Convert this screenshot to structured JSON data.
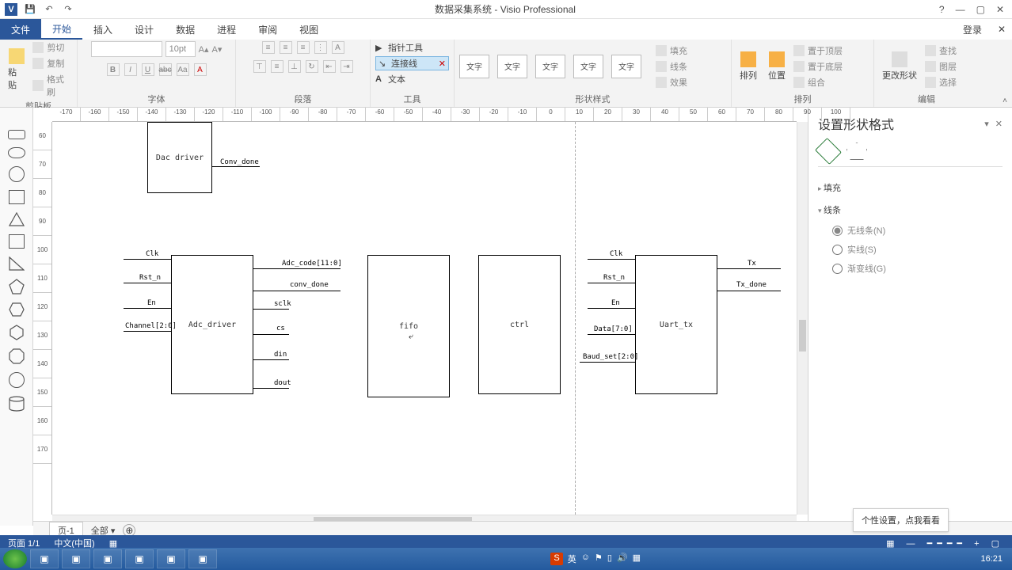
{
  "titlebar": {
    "title": "数据采集系统 - Visio Professional"
  },
  "qat": {
    "save": "💾",
    "undo": "↶",
    "redo": "↷"
  },
  "winbtns": {
    "help": "?",
    "min": "—",
    "max": "▢",
    "close": "✕"
  },
  "tabs": {
    "file": "文件",
    "home": "开始",
    "insert": "插入",
    "design": "设计",
    "data": "数据",
    "process": "进程",
    "review": "审阅",
    "view": "视图",
    "login": "登录",
    "closex": "✕"
  },
  "ribbon": {
    "clipboard": {
      "paste": "粘贴",
      "cut": "剪切",
      "copy": "复制",
      "format_painter": "格式刷",
      "label": "剪贴板"
    },
    "font": {
      "size": "10pt",
      "bold": "B",
      "italic": "I",
      "underline": "U",
      "strike": "abc",
      "case": "Aa",
      "color": "A",
      "grow": "A^",
      "shrink": "A˅",
      "label": "字体"
    },
    "paragraph": {
      "label": "段落"
    },
    "tools": {
      "pointer": "指针工具",
      "connector": "连接线",
      "text": "文本",
      "x": "✕",
      "label": "工具"
    },
    "styles": {
      "swatch": "文字",
      "label": "形状样式",
      "fill": "填充",
      "line": "线条",
      "effects": "效果"
    },
    "arrange": {
      "arrange": "排列",
      "position": "位置",
      "bring_front": "置于顶层",
      "send_back": "置于底层",
      "group": "组合",
      "label": "排列"
    },
    "edit": {
      "change_shape": "更改形状",
      "find": "查找",
      "layers": "图层",
      "select": "选择",
      "label": "编辑"
    }
  },
  "hruler": [
    "-170",
    "-160",
    "-150",
    "-140",
    "-130",
    "-120",
    "-110",
    "-100",
    "-90",
    "-80",
    "-70",
    "-60",
    "-50",
    "-40",
    "-30",
    "-20",
    "-10",
    "0",
    "10",
    "20",
    "30",
    "40",
    "50",
    "60",
    "70",
    "80",
    "90",
    "100"
  ],
  "vruler": [
    "60",
    "70",
    "80",
    "90",
    "100",
    "110",
    "120",
    "130",
    "140",
    "150",
    "160",
    "170"
  ],
  "diagram": {
    "blocks": {
      "dac": "Dac driver",
      "adc": "Adc_driver",
      "fifo": "fifo",
      "ctrl": "ctrl",
      "uart": "Uart_tx"
    },
    "labels": {
      "conv_done_top": "Conv_done",
      "clk1": "Clk",
      "rstn1": "Rst_n",
      "en1": "En",
      "channel": "Channel[2:0]",
      "adc_code": "Adc_code[11:0]",
      "conv_done": "conv_done",
      "sclk": "sclk",
      "cs": "cs",
      "din": "din",
      "dout": "dout",
      "clk2": "Clk",
      "rstn2": "Rst_n",
      "en2": "En",
      "data": "Data[7:0]",
      "baud": "Baud_set[2:0]",
      "tx": "Tx",
      "tx_done": "Tx_done"
    }
  },
  "format_pane": {
    "title": "设置形状格式",
    "sections": {
      "fill": "填充",
      "line": "线条"
    },
    "line_opts": {
      "none": "无线条(N)",
      "solid": "实线(S)",
      "gradient": "渐变线(G)"
    }
  },
  "page_tabs": {
    "page1": "页-1",
    "all": "全部",
    "add": "+"
  },
  "status": {
    "page": "页面 1/1",
    "lang": "中文(中国)"
  },
  "tooltip": "个性设置，点我看看",
  "taskbar": {
    "ime": "S",
    "ime2": "英",
    "clock": "16:21"
  }
}
